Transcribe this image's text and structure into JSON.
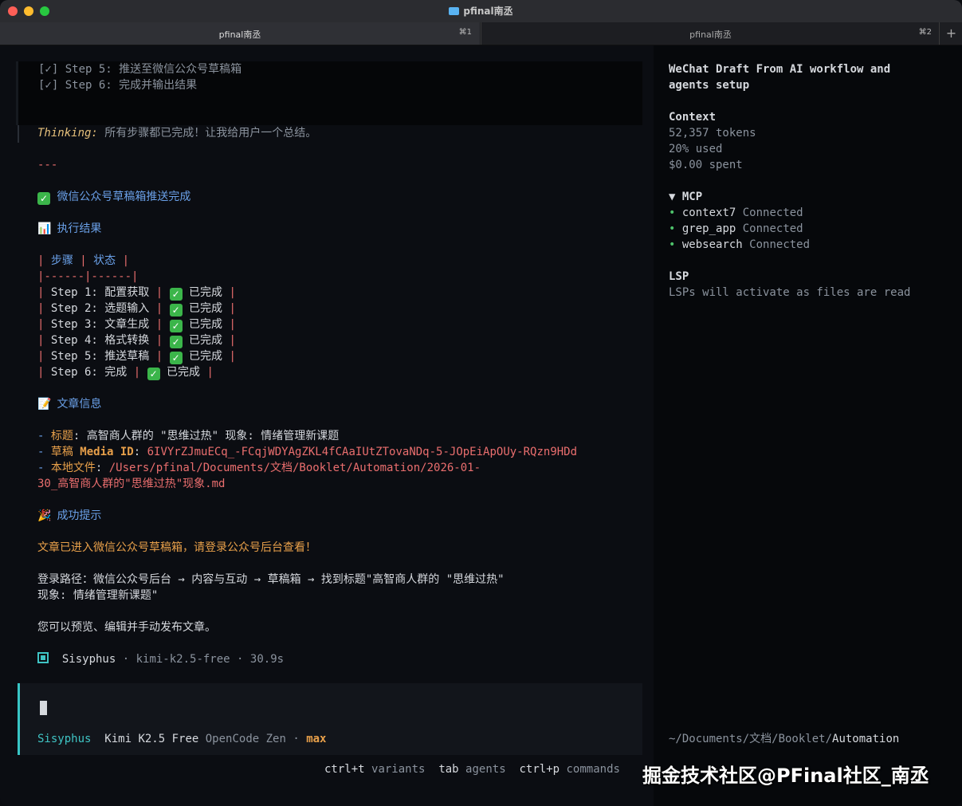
{
  "window": {
    "title": "pfinal南丞"
  },
  "tabs": [
    {
      "label": "pfinal南丞",
      "shortcut": "⌘1"
    },
    {
      "label": "pfinal南丞",
      "shortcut": "⌘2"
    }
  ],
  "new_tab": "+",
  "todo": [
    "[✓] Step 5: 推送至微信公众号草稿箱",
    "[✓] Step 6: 完成并输出结果"
  ],
  "thinking": {
    "label": "Thinking:",
    "text": " 所有步骤都已完成！让我给用户一个总结。"
  },
  "hr": "---",
  "heading1": {
    "emoji": "✓",
    "text": "微信公众号草稿箱推送完成"
  },
  "heading2": {
    "emoji": "📊",
    "text": "执行结果"
  },
  "table": {
    "header": [
      "步骤",
      "状态"
    ],
    "sep": "|------|------|",
    "rows": [
      {
        "step": "Step 1: 配置获取",
        "status": "已完成"
      },
      {
        "step": "Step 2: 选题输入",
        "status": "已完成"
      },
      {
        "step": "Step 3: 文章生成",
        "status": "已完成"
      },
      {
        "step": "Step 4: 格式转换",
        "status": "已完成"
      },
      {
        "step": "Step 5: 推送草稿",
        "status": "已完成"
      },
      {
        "step": "Step 6: 完成",
        "status": "已完成"
      }
    ]
  },
  "heading3": {
    "emoji": "📝",
    "text": "文章信息"
  },
  "info": {
    "title_label": "标题",
    "title_value": ": 高智商人群的 \"思维过热\" 现象: 情绪管理新课题",
    "draft_label": "草稿",
    "media_label": "Media ID",
    "media_value": "6IVYrZJmuECq_-FCqjWDYAgZKL4fCAaIUtZTovaNDq-5-JOpEiApOUy-RQzn9HDd",
    "file_label": "本地文件",
    "file_value1": "/Users/pfinal/Documents/文档/Booklet/Automation/2026-01-",
    "file_value2": "30_高智商人群的\"思维过热\"现象.md"
  },
  "heading4": {
    "emoji": "🎉",
    "text": "成功提示"
  },
  "success": "文章已进入微信公众号草稿箱，请登录公众号后台查看！",
  "path_line1": "登录路径：微信公众号后台 → 内容与互动 → 草稿箱 → 找到标题\"高智商人群的 \"思维过热\"",
  "path_line2": "现象: 情绪管理新课题\"",
  "preview": "您可以预览、编辑并手动发布文章。",
  "status": {
    "agent": "Sisyphus",
    "sep1": " · ",
    "model": "kimi-k2.5-free",
    "sep2": " · ",
    "time": "30.9s"
  },
  "input": {
    "agent": "Sisyphus",
    "model": "Kimi K2.5 Free",
    "provider": "OpenCode Zen",
    "dot": " · ",
    "variant": "max"
  },
  "footer": [
    {
      "key": "ctrl+t",
      "label": "variants"
    },
    {
      "key": "tab",
      "label": "agents"
    },
    {
      "key": "ctrl+p",
      "label": "commands"
    }
  ],
  "sidebar": {
    "title1": "WeChat Draft From AI workflow and",
    "title2": "agents setup",
    "context_label": "Context",
    "tokens": "52,357 tokens",
    "used": "20% used",
    "spent": "$0.00 spent",
    "mcp_label": "▼ MCP",
    "mcp": [
      {
        "name": "context7",
        "status": "Connected"
      },
      {
        "name": "grep_app",
        "status": "Connected"
      },
      {
        "name": "websearch",
        "status": "Connected"
      }
    ],
    "lsp_label": "LSP",
    "lsp_text": "LSPs will activate as files are read",
    "cwd_prefix": "~/Documents/文档/Booklet/",
    "cwd_last": "Automation"
  },
  "watermark": "掘金技术社区@PFinal社区_南丞"
}
